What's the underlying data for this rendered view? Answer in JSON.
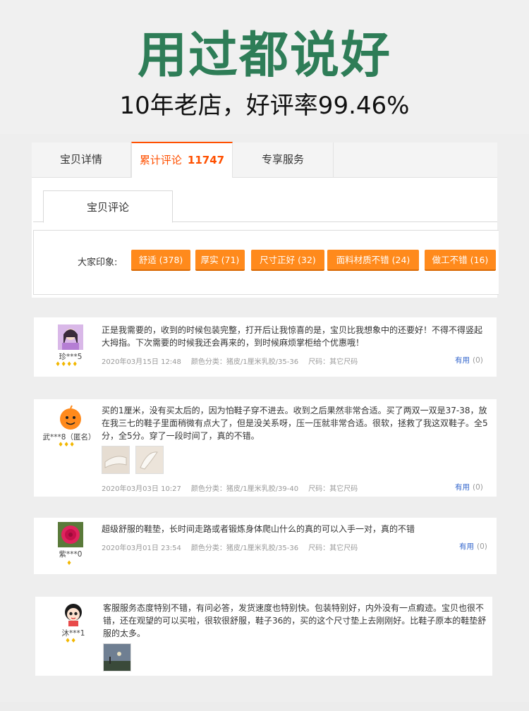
{
  "banner": {
    "headline": "用过都说好",
    "subline": "10年老店，好评率99.46%"
  },
  "tabs": {
    "detail": "宝贝详情",
    "reviews": "累计评论",
    "reviews_count": "11747",
    "service": "专享服务"
  },
  "subtab": "宝贝评论",
  "impressions": {
    "label": "大家印象:",
    "tags": [
      "舒适 (378)",
      "厚实 (71)",
      "尺寸正好 (32)",
      "面料材质不错 (24)",
      "做工不错 (16)"
    ]
  },
  "reviews": [
    {
      "user": "珍***5",
      "gems": "♦♦♦♦",
      "text": "正是我需要的，收到的时候包装完整，打开后让我惊喜的是，宝贝比我想象中的还要好！不得不得竖起大拇指。下次需要的时候我还会再来的，到时候麻烦掌柜给个优惠哦！",
      "date": "2020年03月15日 12:48",
      "color_class": "颜色分类：猪皮/1厘米乳胶/35-36",
      "size": "尺码：其它尺码",
      "useful": "有用",
      "useful_count": "(0)"
    },
    {
      "user": "武***8（匿名）",
      "gems": "♦♦♦",
      "text": "买的1厘米，没有买太后的，因为怕鞋子穿不进去。收到之后果然非常合适。买了两双一双是37-38，放在我三七的鞋子里面稍微有点大了，但是没关系呀，压一压就非常合适。很软，拯救了我这双鞋子。全5分，全5分。穿了一段时间了，真的不错。",
      "date": "2020年03月03日 10:27",
      "color_class": "颜色分类：猪皮/1厘米乳胶/39-40",
      "size": "尺码：其它尺码",
      "useful": "有用",
      "useful_count": "(0)"
    },
    {
      "user": "紫***0",
      "gems": "♦",
      "text": "超级舒服的鞋垫，长时间走路或者锻炼身体爬山什么的真的可以入手一对，真的不错",
      "date": "2020年03月01日 23:54",
      "color_class": "颜色分类：猪皮/1厘米乳胶/35-36",
      "size": "尺码：其它尺码",
      "useful": "有用",
      "useful_count": "(0)"
    },
    {
      "user": "沐***1",
      "gems": "♦♦",
      "text": "客服服务态度特别不错，有问必答，发货速度也特别快。包装特别好，内外没有一点瘕迹。宝贝也很不错，还在观望的可以买啦，很软很舒服，鞋子36的，买的这个尺寸垫上去刚刚好。比鞋子原本的鞋垫舒服的太多。"
    }
  ],
  "colors": {
    "accent": "#ff5000",
    "tag": "#ff8a1c",
    "headline": "#2e7d57",
    "link": "#3366cc",
    "gem": "#f2b700"
  }
}
